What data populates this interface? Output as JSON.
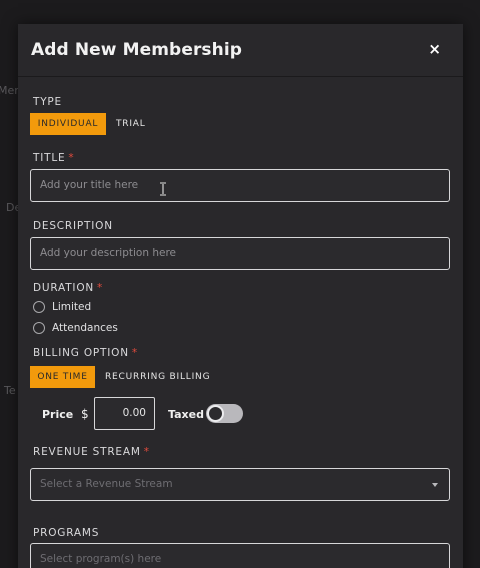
{
  "background": {
    "text_a": "Mem",
    "text_b": "De",
    "text_c": "Te"
  },
  "modal": {
    "title": "Add New Membership",
    "close_glyph": "×"
  },
  "type": {
    "label": "TYPE",
    "options": [
      "INDIVIDUAL",
      "TRIAL"
    ],
    "selected": "INDIVIDUAL"
  },
  "title_field": {
    "label": "TITLE",
    "required_mark": "*",
    "placeholder": "Add your title here"
  },
  "description_field": {
    "label": "DESCRIPTION",
    "placeholder": "Add your description here"
  },
  "duration": {
    "label": "DURATION",
    "required_mark": "*",
    "options": [
      "Limited",
      "Attendances"
    ]
  },
  "billing": {
    "label": "BILLING OPTION",
    "required_mark": "*",
    "options": [
      "ONE TIME",
      "RECURRING BILLING"
    ],
    "selected": "ONE TIME"
  },
  "price": {
    "label": "Price",
    "currency": "$",
    "value": "0.00",
    "taxed_label": "Taxed",
    "taxed_on": false
  },
  "revenue_stream": {
    "label": "REVENUE STREAM",
    "required_mark": "*",
    "placeholder": "Select a Revenue Stream"
  },
  "programs": {
    "label": "PROGRAMS",
    "placeholder": "Select program(s) here"
  },
  "colors": {
    "accent": "#f29a0c",
    "modal_bg": "#29282b",
    "required": "#e24b3d"
  }
}
